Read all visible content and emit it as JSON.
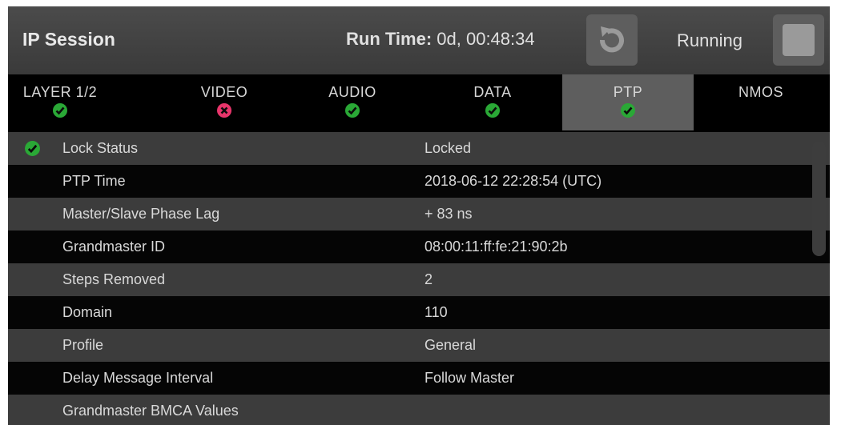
{
  "header": {
    "title": "IP Session",
    "runtime_label": "Run Time:",
    "runtime_value": "0d, 00:48:34",
    "status": "Running"
  },
  "tabs": [
    {
      "label": "LAYER 1/2",
      "status": "ok"
    },
    {
      "label": "VIDEO",
      "status": "error"
    },
    {
      "label": "AUDIO",
      "status": "ok"
    },
    {
      "label": "DATA",
      "status": "ok"
    },
    {
      "label": "PTP",
      "status": "ok",
      "active": true
    },
    {
      "label": "NMOS",
      "status": "none"
    }
  ],
  "rows": [
    {
      "name": "Lock Status",
      "value": "Locked",
      "status": "ok"
    },
    {
      "name": "PTP Time",
      "value": "2018-06-12 22:28:54 (UTC)"
    },
    {
      "name": "Master/Slave Phase Lag",
      "value": "+ 83 ns"
    },
    {
      "name": "Grandmaster ID",
      "value": "08:00:11:ff:fe:21:90:2b"
    },
    {
      "name": "Steps Removed",
      "value": "2"
    },
    {
      "name": "Domain",
      "value": "110"
    },
    {
      "name": "Profile",
      "value": "General"
    },
    {
      "name": "Delay Message Interval",
      "value": "Follow Master"
    },
    {
      "name": "Grandmaster BMCA Values",
      "value": ""
    }
  ],
  "colors": {
    "ok": "#2aa836",
    "error": "#e8356b",
    "header_bg": "#444444",
    "tab_active_bg": "#5e5e5e"
  }
}
